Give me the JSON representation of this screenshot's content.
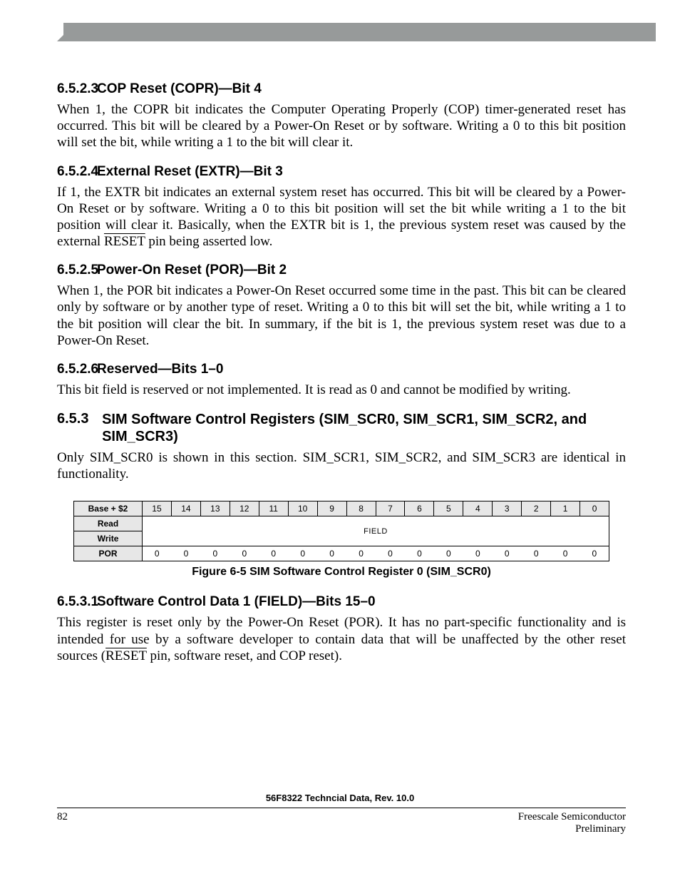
{
  "sections": {
    "s6523": {
      "num": "6.5.2.3",
      "title": "COP Reset (COPR)—Bit 4",
      "body": "When 1, the COPR bit indicates the Computer Operating Properly (COP) timer-generated reset has occurred. This bit will be cleared by a Power-On Reset or by software. Writing a 0 to this bit position will set the bit, while writing a 1 to the bit will clear it."
    },
    "s6524": {
      "num": "6.5.2.4",
      "title": "External Reset (EXTR)—Bit 3",
      "body_a": "If 1, the EXTR bit indicates an external system reset has occurred. This bit will be cleared by a Power-On Reset or by software. Writing a 0 to this bit position will set the bit while writing a 1 to the bit position will clear it. Basically, when the EXTR bit is 1, the previous system reset was caused by the external ",
      "body_reset": "RESET",
      "body_b": " pin being asserted low."
    },
    "s6525": {
      "num": "6.5.2.5",
      "title": "Power-On Reset (POR)—Bit 2",
      "body": "When 1, the POR bit indicates a Power-On Reset occurred some time in the past. This bit can be cleared only by software or by another type of reset. Writing a 0 to this bit will set the bit, while writing a 1 to the bit position will clear the bit. In summary, if the bit is 1, the previous system reset was due to a Power-On Reset."
    },
    "s6526": {
      "num": "6.5.2.6",
      "title": "Reserved—Bits 1–0",
      "body": "This bit field is reserved or not implemented. It is read as 0 and cannot be modified by writing."
    },
    "s653": {
      "num": "6.5.3",
      "title": "SIM Software Control Registers (SIM_SCR0, SIM_SCR1, SIM_SCR2, and SIM_SCR3)",
      "body": "Only SIM_SCR0 is shown in this section. SIM_SCR1, SIM_SCR2, and SIM_SCR3 are identical in functionality."
    },
    "s6531": {
      "num": "6.5.3.1",
      "title": "Software Control Data 1 (FIELD)—Bits 15–0",
      "body_a": "This register is reset only by the Power-On Reset (POR). It has no part-specific functionality and is intended for use by a software developer to contain data that will be unaffected by the other reset sources (",
      "body_reset": "RESET",
      "body_b": " pin, software reset, and COP reset)."
    }
  },
  "table": {
    "addr": "Base + $2",
    "bits": [
      "15",
      "14",
      "13",
      "12",
      "11",
      "10",
      "9",
      "8",
      "7",
      "6",
      "5",
      "4",
      "3",
      "2",
      "1",
      "0"
    ],
    "read": "Read",
    "write": "Write",
    "field": "FIELD",
    "por_label": "POR",
    "por": [
      "0",
      "0",
      "0",
      "0",
      "0",
      "0",
      "0",
      "0",
      "0",
      "0",
      "0",
      "0",
      "0",
      "0",
      "0",
      "0"
    ],
    "caption": "Figure 6-5 SIM Software Control Register 0 (SIM_SCR0)"
  },
  "footer": {
    "center": "56F8322 Techncial Data, Rev. 10.0",
    "page": "82",
    "right1": "Freescale Semiconductor",
    "right2": "Preliminary"
  }
}
